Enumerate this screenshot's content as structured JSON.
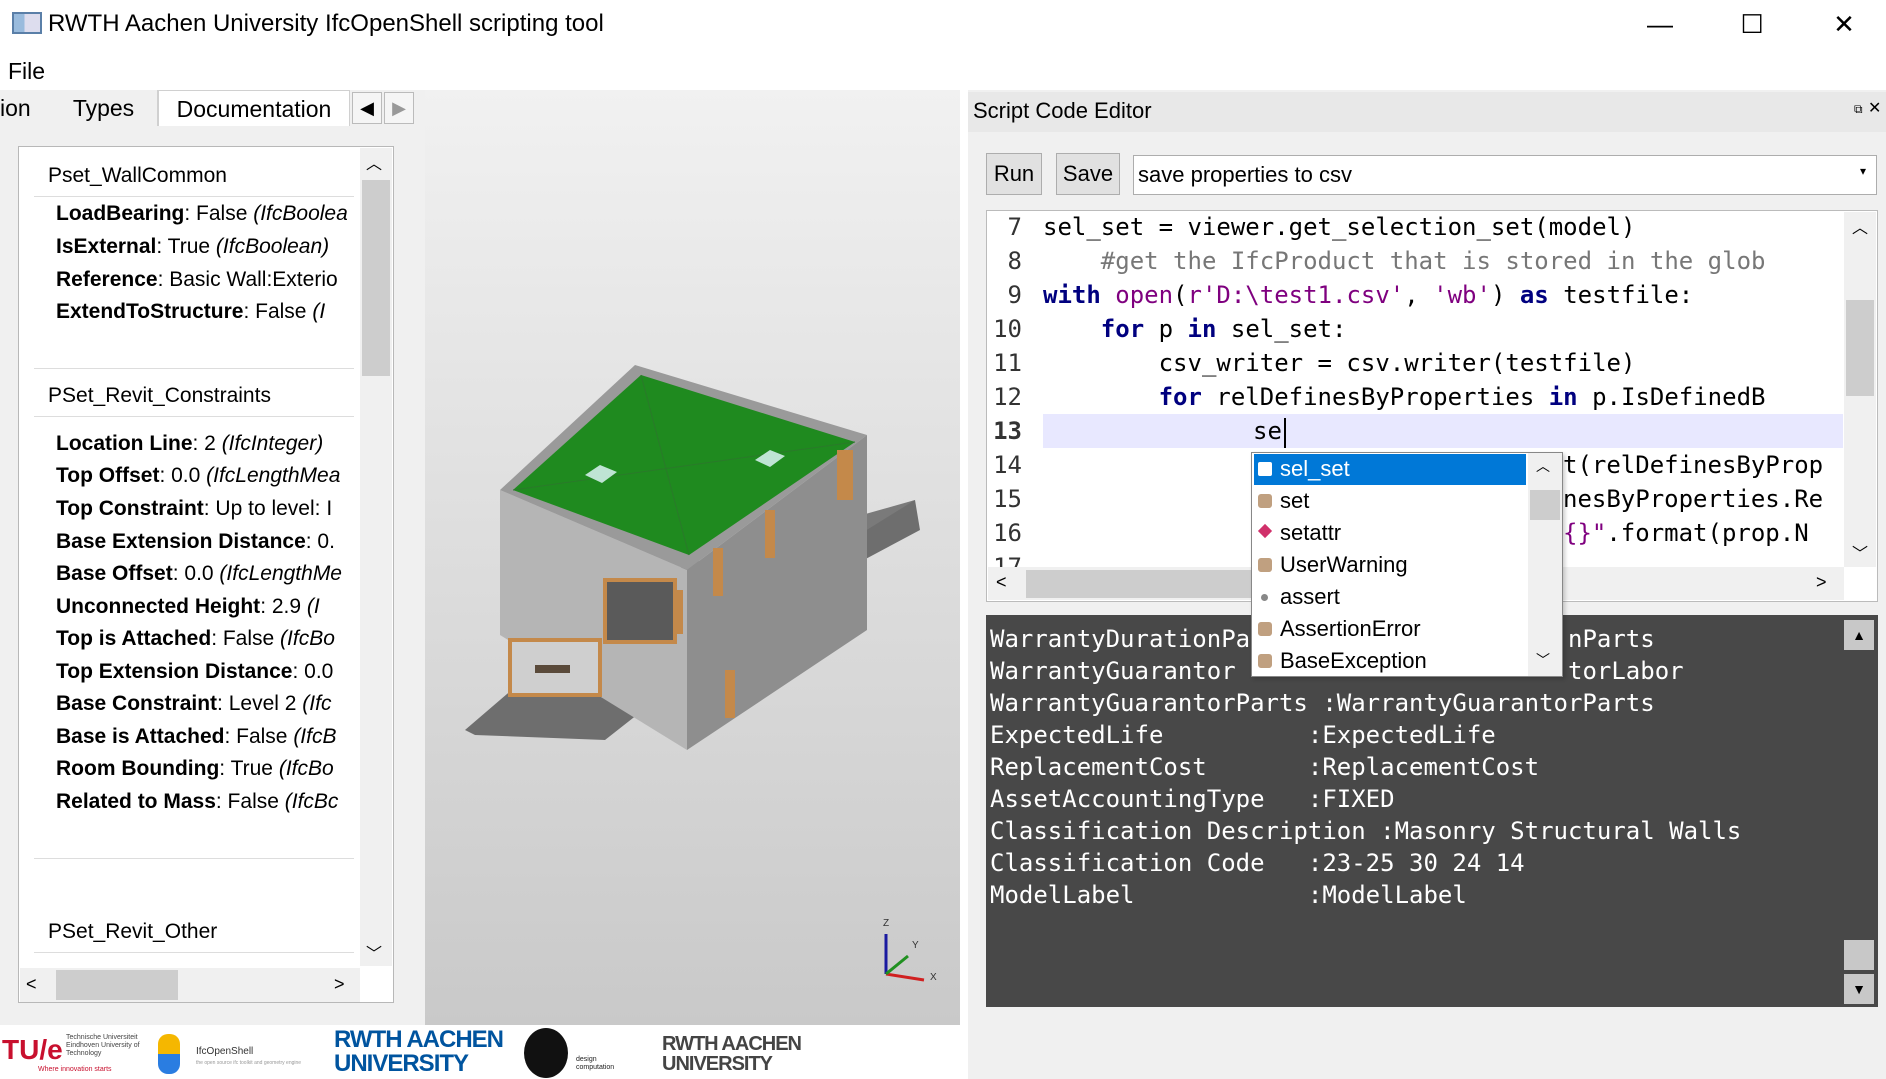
{
  "window": {
    "title": "RWTH Aachen University IfcOpenShell scripting tool",
    "minimize": "—",
    "maximize": "☐",
    "close": "✕"
  },
  "menu": {
    "file": "File"
  },
  "left_tabs": {
    "partial": "ion",
    "types": "Types",
    "documentation": "Documentation",
    "left_arrow": "◀",
    "right_arrow": "▶"
  },
  "psets": [
    {
      "title": "Pset_WallCommon",
      "props": [
        {
          "name": "LoadBearing",
          "value": ": False ",
          "type": "(IfcBoolea"
        },
        {
          "name": "IsExternal",
          "value": ": True ",
          "type": "(IfcBoolean)"
        },
        {
          "name": "Reference",
          "value": ": Basic Wall:Exterio",
          "type": ""
        },
        {
          "name": "ExtendToStructure",
          "value": ": False ",
          "type": "(I"
        }
      ]
    },
    {
      "title": "PSet_Revit_Constraints",
      "props": [
        {
          "name": "Location Line",
          "value": ": 2 ",
          "type": "(IfcInteger)"
        },
        {
          "name": "Top Offset",
          "value": ": 0.0 ",
          "type": "(IfcLengthMea"
        },
        {
          "name": "Top Constraint",
          "value": ": Up to level: I",
          "type": ""
        },
        {
          "name": "Base Extension Distance",
          "value": ": 0.",
          "type": ""
        },
        {
          "name": "Base Offset",
          "value": ": 0.0 ",
          "type": "(IfcLengthMe"
        },
        {
          "name": "Unconnected Height",
          "value": ": 2.9 ",
          "type": "(I"
        },
        {
          "name": "Top is Attached",
          "value": ": False ",
          "type": "(IfcBo"
        },
        {
          "name": "Top Extension Distance",
          "value": ": 0.0",
          "type": ""
        },
        {
          "name": "Base Constraint",
          "value": ": Level 2 ",
          "type": "(Ifc"
        },
        {
          "name": "Base is Attached",
          "value": ": False ",
          "type": "(IfcB"
        },
        {
          "name": "Room Bounding",
          "value": ": True ",
          "type": "(IfcBo"
        },
        {
          "name": "Related to Mass",
          "value": ": False ",
          "type": "(IfcBc"
        }
      ]
    },
    {
      "title": "PSet_Revit_Other",
      "props": []
    }
  ],
  "editor": {
    "title": "Script Code Editor",
    "run": "Run",
    "save": "Save",
    "script_name": "save properties to csv",
    "lines": [
      {
        "n": "7"
      },
      {
        "n": "8"
      },
      {
        "n": "9"
      },
      {
        "n": "10"
      },
      {
        "n": "11"
      },
      {
        "n": "12"
      },
      {
        "n": "13"
      },
      {
        "n": "14"
      },
      {
        "n": "15"
      },
      {
        "n": "16"
      },
      {
        "n": "17"
      }
    ],
    "code7": "sel_set = viewer.get_selection_set(model)",
    "code8": "    #get the IfcProduct that is stored in the glob",
    "code9_kw1": "with",
    "code9_bi": "open",
    "code9_a": "(",
    "code9_str1": "r'D:\\test1.csv'",
    "code9_b": ", ",
    "code9_str2": "'wb'",
    "code9_c": ") ",
    "code9_kw2": "as",
    "code9_d": " testfile:",
    "code10_kw": "for",
    "code10_a": " p ",
    "code10_kw2": "in",
    "code10_b": " sel_set:",
    "code11": "        csv_writer = csv.writer(testfile)",
    "code12_kw": "for",
    "code12_a": " relDefinesByProperties ",
    "code12_kw2": "in",
    "code12_b": " p.IsDefinedB",
    "code13": "se",
    "code14": "t(relDefinesByProp",
    "code15": "nesByProperties.Re",
    "code16_str": "{}\"",
    "code16": ".format(prop.N"
  },
  "autocomplete": [
    "sel_set",
    "set",
    "setattr",
    "UserWarning",
    "assert",
    "AssertionError",
    "BaseException"
  ],
  "console": [
    "WarrantyDurationPa",
    "WarrantyGuarantor",
    "WarrantyGuarantorParts :WarrantyGuarantorParts",
    "ExpectedLife          :ExpectedLife",
    "ReplacementCost       :ReplacementCost",
    "AssetAccountingType   :FIXED",
    "Classification Description :Masonry Structural Walls",
    "Classification Code   :23-25 30 24 14",
    "ModelLabel            :ModelLabel"
  ],
  "console_tail": {
    "line1": "nParts",
    "line2": "torLabor"
  },
  "axes": {
    "z": "Z",
    "y": "Y",
    "x": "X"
  },
  "logos": {
    "tue": "TU/e",
    "tue_small": "Technische Universiteit Eindhoven University of Technology",
    "tue_tag": "Where innovation starts",
    "ifcos": "IfcOpenShell",
    "ifcos_small": "the open source ifc toolkit and geometry engine",
    "rwth1": "RWTH AACHEN UNIVERSITY",
    "dc": "design computation",
    "rwth2": "RWTH AACHEN UNIVERSITY"
  },
  "colors": {
    "roof": "#1f8a1f",
    "wall": "#8e8e8e",
    "console_bg": "#484848",
    "selection": "#0078d7"
  }
}
